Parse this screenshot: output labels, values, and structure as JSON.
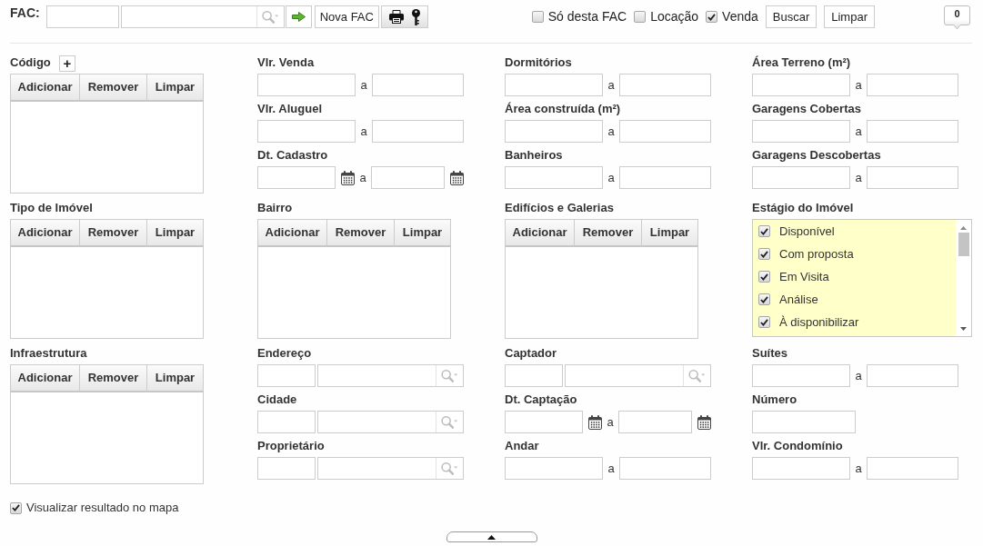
{
  "toolbar": {
    "fac_label": "FAC:",
    "buttons": [
      {
        "kind": "go"
      },
      {
        "kind": "text",
        "label": "Nova FAC"
      },
      {
        "kind": "print_key"
      }
    ],
    "checkboxes": [
      {
        "label": "Só desta FAC",
        "checked": false
      },
      {
        "label": "Locação",
        "checked": false
      },
      {
        "label": "Venda",
        "checked": true
      }
    ],
    "actions": [
      "Buscar",
      "Limpar"
    ],
    "counter": "0"
  },
  "rows": [
    {
      "columns": [
        {
          "fields": [
            {
              "kind": "list",
              "label": "Código",
              "add_label": "+",
              "buttons": [
                "Adicionar",
                "Remover",
                "Limpar"
              ]
            }
          ]
        },
        {
          "fields": [
            {
              "kind": "range",
              "label": "Vlr. Venda",
              "separator": "a"
            },
            {
              "kind": "range",
              "label": "Vlr. Aluguel",
              "separator": "a"
            },
            {
              "kind": "date_range",
              "label": "Dt. Cadastro",
              "separator": "a"
            }
          ]
        },
        {
          "fields": [
            {
              "kind": "range",
              "label": "Dormitórios",
              "separator": "a"
            },
            {
              "kind": "range",
              "label": "Área construída (m²)",
              "separator": "a"
            },
            {
              "kind": "range",
              "label": "Banheiros",
              "separator": "a"
            }
          ]
        },
        {
          "fields": [
            {
              "kind": "range",
              "label": "Área Terreno (m²)",
              "separator": "a"
            },
            {
              "kind": "range",
              "label": "Garagens Cobertas",
              "separator": "a"
            },
            {
              "kind": "range",
              "label": "Garagens Descobertas",
              "separator": "a"
            }
          ]
        }
      ]
    },
    {
      "columns": [
        {
          "fields": [
            {
              "kind": "list",
              "label": "Tipo de Imóvel",
              "buttons": [
                "Adicionar",
                "Remover",
                "Limpar"
              ]
            }
          ]
        },
        {
          "fields": [
            {
              "kind": "list",
              "label": "Bairro",
              "buttons": [
                "Adicionar",
                "Remover",
                "Limpar"
              ]
            }
          ]
        },
        {
          "fields": [
            {
              "kind": "list",
              "label": "Edifícios e Galerias",
              "buttons": [
                "Adicionar",
                "Remover",
                "Limpar"
              ]
            }
          ]
        },
        {
          "fields": [
            {
              "kind": "checklist",
              "label": "Estágio do Imóvel",
              "items": [
                {
                  "label": "Disponível",
                  "checked": true
                },
                {
                  "label": "Com proposta",
                  "checked": true
                },
                {
                  "label": "Em Visita",
                  "checked": true
                },
                {
                  "label": "Análise",
                  "checked": true
                },
                {
                  "label": "À disponibilizar",
                  "checked": true
                }
              ]
            }
          ]
        }
      ]
    },
    {
      "columns": [
        {
          "fields": [
            {
              "kind": "list",
              "label": "Infraestrutura",
              "buttons": [
                "Adicionar",
                "Remover",
                "Limpar"
              ]
            }
          ]
        },
        {
          "fields": [
            {
              "kind": "lookup",
              "label": "Endereço"
            },
            {
              "kind": "lookup",
              "label": "Cidade"
            },
            {
              "kind": "lookup",
              "label": "Proprietário"
            }
          ]
        },
        {
          "fields": [
            {
              "kind": "lookup",
              "label": "Captador"
            },
            {
              "kind": "date_range",
              "label": "Dt. Captação",
              "separator": "a"
            },
            {
              "kind": "range",
              "label": "Andar",
              "separator": "a"
            }
          ]
        },
        {
          "fields": [
            {
              "kind": "range",
              "label": "Suítes",
              "separator": "a"
            },
            {
              "kind": "single",
              "label": "Número"
            },
            {
              "kind": "range",
              "label": "Vlr. Condomínio",
              "separator": "a"
            }
          ]
        }
      ]
    }
  ],
  "show_on_map": {
    "label": "Visualizar resultado no mapa",
    "checked": true
  }
}
